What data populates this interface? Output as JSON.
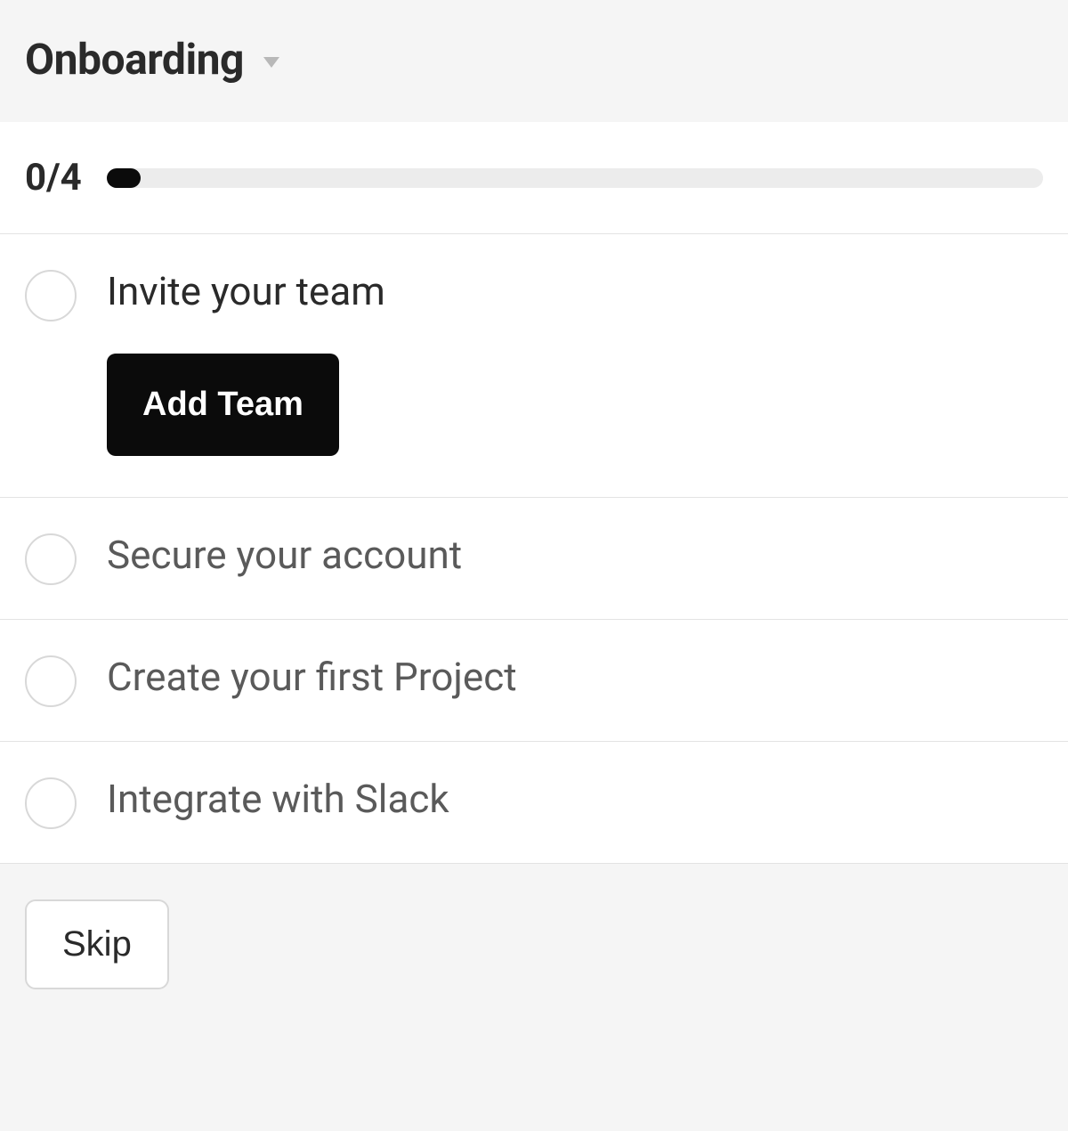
{
  "header": {
    "title": "Onboarding"
  },
  "progress": {
    "label": "0/4",
    "completed": 0,
    "total": 4
  },
  "tasks": [
    {
      "title": "Invite your team",
      "expanded": true,
      "action_label": "Add Team"
    },
    {
      "title": "Secure your account",
      "expanded": false
    },
    {
      "title": "Create your first Project",
      "expanded": false
    },
    {
      "title": "Integrate with Slack",
      "expanded": false
    }
  ],
  "footer": {
    "skip_label": "Skip"
  }
}
